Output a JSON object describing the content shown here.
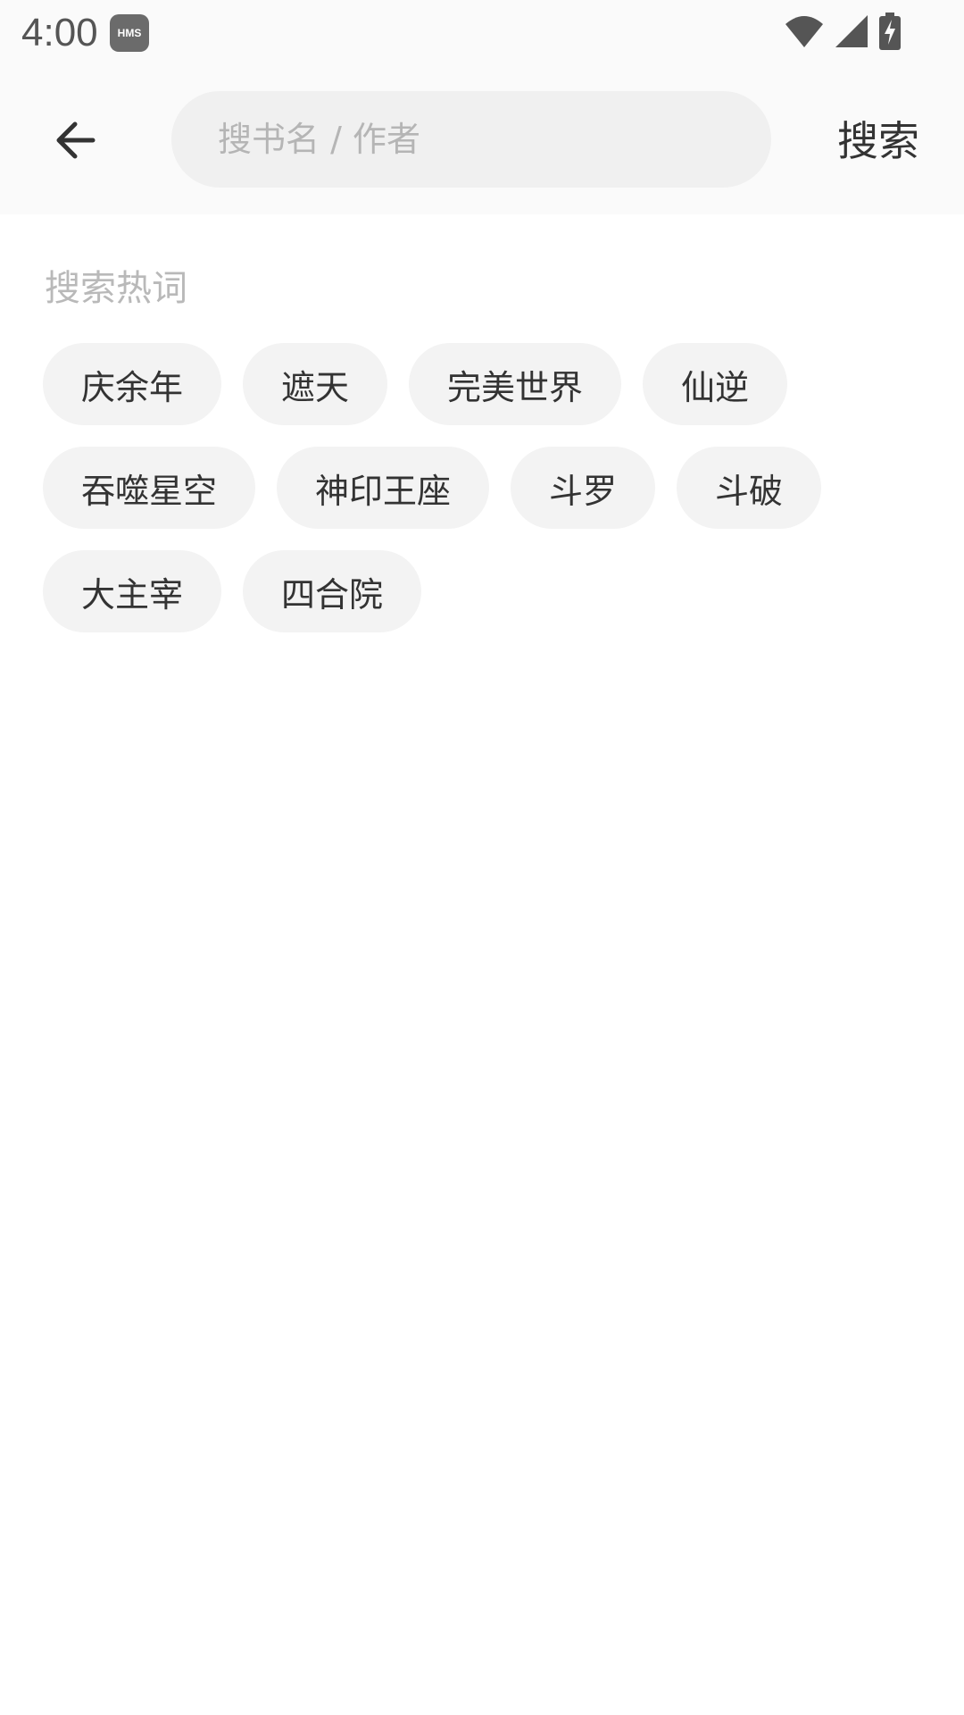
{
  "status_bar": {
    "time": "4:00",
    "badge": "HMS",
    "icons": [
      "wifi-icon",
      "signal-icon",
      "battery-charging-icon"
    ]
  },
  "header": {
    "back_icon": "arrow-left-icon",
    "search_placeholder": "搜书名 / 作者",
    "search_value": "",
    "search_button": "搜索"
  },
  "hot_words": {
    "title": "搜索热词",
    "rows": [
      [
        "庆余年",
        "遮天",
        "完美世界",
        "仙逆"
      ],
      [
        "吞噬星空",
        "神印王座",
        "斗罗",
        "斗破"
      ],
      [
        "大主宰",
        "四合院"
      ]
    ]
  }
}
